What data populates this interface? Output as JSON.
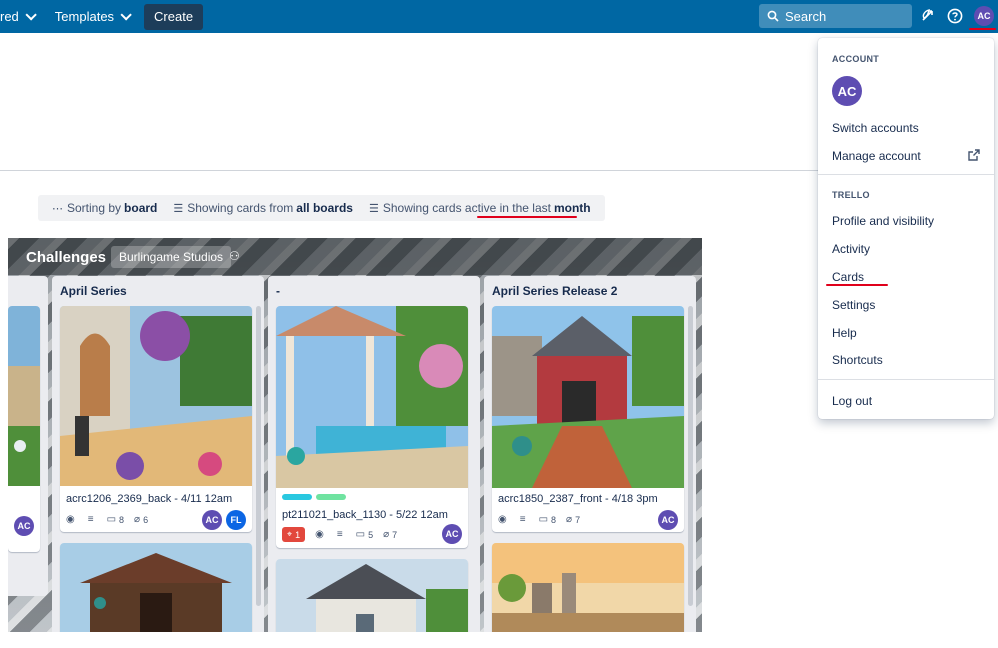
{
  "nav": {
    "starred_label": "red",
    "templates_label": "Templates",
    "create_label": "Create",
    "search_placeholder": "Search",
    "avatar_initials": "AC"
  },
  "filters": {
    "sorting_prefix": "Sorting by",
    "sorting_value": "board",
    "showing_prefix": "Showing cards from",
    "showing_value": "all boards",
    "active_prefix": "Showing cards active in the last",
    "active_value": "month"
  },
  "board": {
    "title": "Challenges",
    "workspace": "Burlingame Studios",
    "lists": [
      {
        "title": "",
        "cards": [
          {
            "title": "",
            "members": [
              "AC"
            ]
          }
        ]
      },
      {
        "title": "April Series",
        "cards": [
          {
            "title": "acrc1206_2369_back - 4/11 12am",
            "comments": "8",
            "attachments": "6",
            "members": [
              "AC",
              "FL"
            ]
          }
        ]
      },
      {
        "title": "-",
        "cards": [
          {
            "title": "pt211021_back_1130 - 5/22 12am",
            "votes": "1",
            "comments": "5",
            "attachments": "7",
            "members": [
              "AC"
            ]
          }
        ]
      },
      {
        "title": "April Series Release 2",
        "cards": [
          {
            "title": "acrc1850_2387_front - 4/18 3pm",
            "comments": "8",
            "attachments": "7",
            "members": [
              "AC"
            ]
          }
        ]
      }
    ]
  },
  "menu": {
    "account_heading": "ACCOUNT",
    "avatar_initials": "AC",
    "switch_accounts": "Switch accounts",
    "manage_account": "Manage account",
    "trello_heading": "TRELLO",
    "profile": "Profile and visibility",
    "activity": "Activity",
    "cards": "Cards",
    "settings": "Settings",
    "help": "Help",
    "shortcuts": "Shortcuts",
    "logout": "Log out"
  },
  "colors": {
    "nav_bg": "#0067a3",
    "annotation_red": "#e0001b",
    "avatar_ac": "#5e4db2",
    "avatar_fl": "#0c66e4",
    "label_cyan": "#29c8e0",
    "label_green": "#6fe3a0",
    "vote_red": "#e2483d"
  }
}
